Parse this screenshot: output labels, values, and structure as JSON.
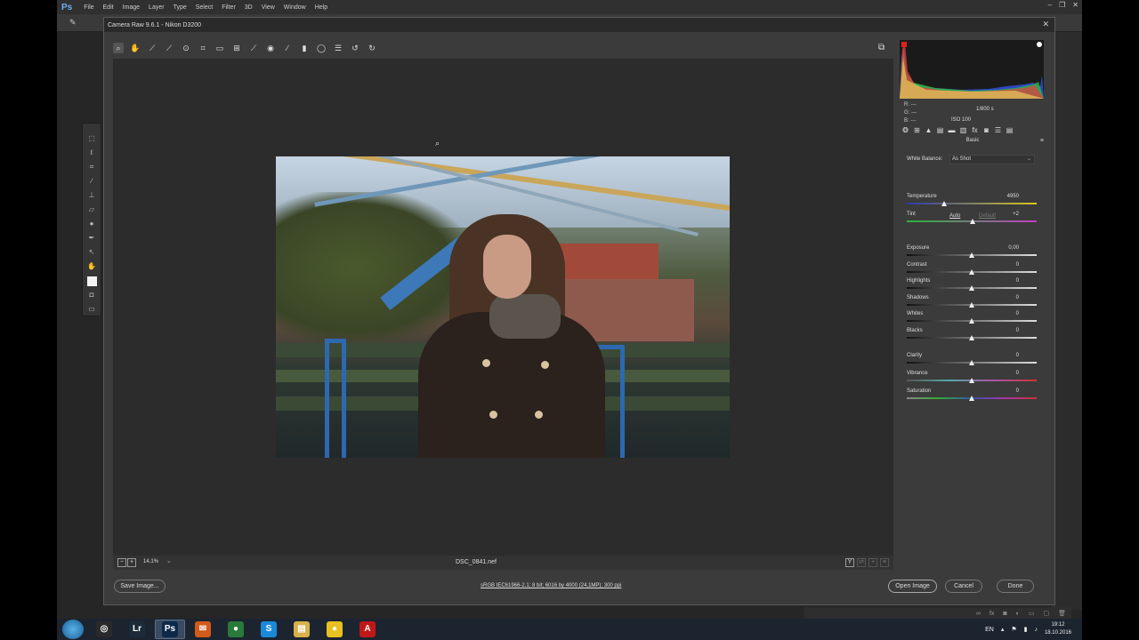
{
  "photoshop": {
    "logo": "Ps",
    "menu": [
      "File",
      "Edit",
      "Image",
      "Layer",
      "Type",
      "Select",
      "Filter",
      "3D",
      "View",
      "Window",
      "Help"
    ]
  },
  "camera_raw": {
    "title": "Camera Raw 9.6.1  -  Nikon D3200",
    "close_glyph": "✕",
    "toolbar_icons": [
      "zoom-icon",
      "hand-icon",
      "white-balance-icon",
      "color-sampler-icon",
      "targeted-adjustment-icon",
      "crop-icon",
      "straighten-icon",
      "transform-icon",
      "spot-removal-icon",
      "red-eye-icon",
      "adjustment-brush-icon",
      "graduated-filter-icon",
      "radial-filter-icon",
      "preferences-icon",
      "rotate-ccw-icon",
      "rotate-cw-icon"
    ],
    "histogram": {
      "rgb_labels": [
        "R:",
        "G:",
        "B:"
      ],
      "rgb_values": [
        "---",
        "---",
        "---"
      ],
      "shutter": "1/800 s",
      "iso": "ISO 100"
    },
    "panel_title": "Basic",
    "white_balance": {
      "label": "White Balance:",
      "value": "As Shot"
    },
    "auto_label": "Auto",
    "default_label": "Default",
    "sliders": [
      {
        "name": "temperature",
        "label": "Temperature",
        "value": "4950",
        "level": 0.29,
        "track": "temp"
      },
      {
        "name": "tint",
        "label": "Tint",
        "value": "+2",
        "level": 0.505,
        "track": "tint"
      },
      {
        "name": "exposure",
        "label": "Exposure",
        "value": "0,00",
        "level": 0.5,
        "track": ""
      },
      {
        "name": "contrast",
        "label": "Contrast",
        "value": "0",
        "level": 0.5,
        "track": ""
      },
      {
        "name": "highlights",
        "label": "Highlights",
        "value": "0",
        "level": 0.5,
        "track": ""
      },
      {
        "name": "shadows",
        "label": "Shadows",
        "value": "0",
        "level": 0.5,
        "track": ""
      },
      {
        "name": "whites",
        "label": "Whites",
        "value": "0",
        "level": 0.5,
        "track": ""
      },
      {
        "name": "blacks",
        "label": "Blacks",
        "value": "0",
        "level": 0.5,
        "track": ""
      },
      {
        "name": "clarity",
        "label": "Clarity",
        "value": "0",
        "level": 0.5,
        "track": ""
      },
      {
        "name": "vibrance",
        "label": "Vibrance",
        "value": "0",
        "level": 0.5,
        "track": "vib"
      },
      {
        "name": "saturation",
        "label": "Saturation",
        "value": "0",
        "level": 0.5,
        "track": "sat"
      }
    ],
    "status": {
      "zoom": "14,1%",
      "file_name": "DSC_0841.nef"
    },
    "buttons": {
      "save_image": "Save Image...",
      "workflow": "sRGB IEC61966-2.1; 8 bit; 6016 by 4000 (24,1MP); 300 ppi",
      "open_image": "Open Image",
      "cancel": "Cancel",
      "done": "Done"
    }
  },
  "taskbar": {
    "apps": [
      {
        "name": "obs",
        "glyph": "◎",
        "color": "#2a2a2a"
      },
      {
        "name": "lightroom",
        "glyph": "Lr",
        "color": "#1c2b3a"
      },
      {
        "name": "photoshop",
        "glyph": "Ps",
        "color": "#0c2a4a"
      },
      {
        "name": "mail",
        "glyph": "✉",
        "color": "#d25a1a"
      },
      {
        "name": "chrome",
        "glyph": "●",
        "color": "#2a7a3a"
      },
      {
        "name": "skype",
        "glyph": "S",
        "color": "#1a8ad8"
      },
      {
        "name": "explorer",
        "glyph": "▤",
        "color": "#d8b248"
      },
      {
        "name": "norton",
        "glyph": "●",
        "color": "#e8c020"
      },
      {
        "name": "acrobat",
        "glyph": "A",
        "color": "#c01818"
      }
    ],
    "language": "EN",
    "time": "19:12",
    "date": "18.10.2016"
  }
}
